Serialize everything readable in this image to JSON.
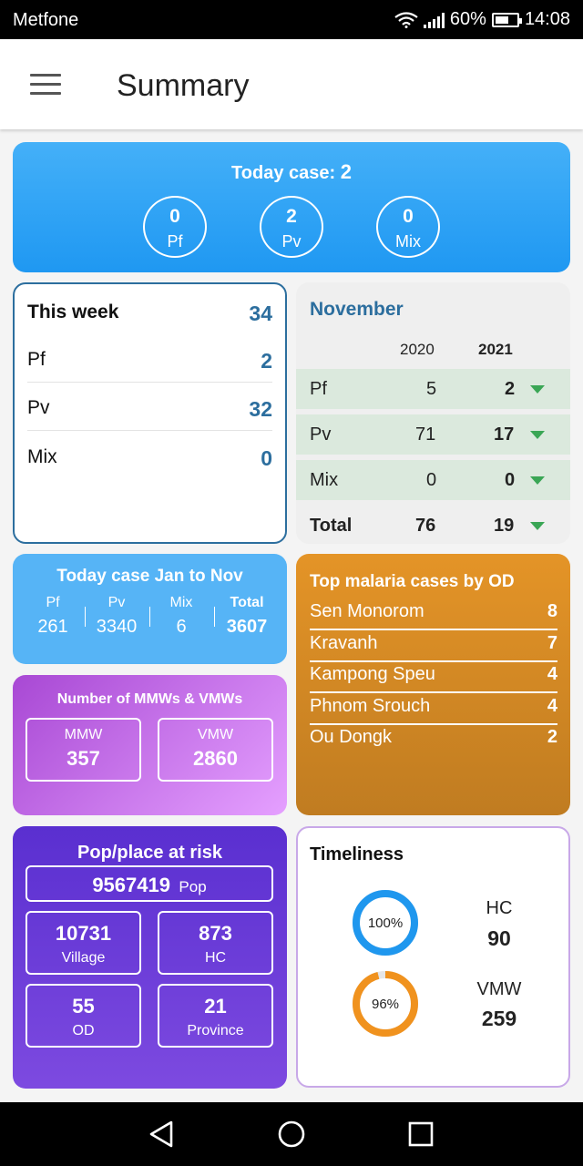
{
  "status": {
    "carrier": "Metfone",
    "battery": "60%",
    "time": "14:08"
  },
  "header": {
    "title": "Summary"
  },
  "today": {
    "label": "Today case:",
    "total": "2",
    "items": [
      {
        "value": "0",
        "label": "Pf"
      },
      {
        "value": "2",
        "label": "Pv"
      },
      {
        "value": "0",
        "label": "Mix"
      }
    ]
  },
  "week": {
    "title": "This week",
    "total": "34",
    "rows": [
      {
        "label": "Pf",
        "value": "2"
      },
      {
        "label": "Pv",
        "value": "32"
      },
      {
        "label": "Mix",
        "value": "0"
      }
    ]
  },
  "month": {
    "title": "November",
    "years": [
      "2020",
      "2021"
    ],
    "rows": [
      {
        "label": "Pf",
        "prev": "5",
        "curr": "2"
      },
      {
        "label": "Pv",
        "prev": "71",
        "curr": "17"
      },
      {
        "label": "Mix",
        "prev": "0",
        "curr": "0"
      },
      {
        "label": "Total",
        "prev": "76",
        "curr": "19"
      }
    ],
    "trend_color": "#3aa655"
  },
  "jan_nov": {
    "title": "Today case Jan to Nov",
    "cols": [
      {
        "label": "Pf",
        "value": "261"
      },
      {
        "label": "Pv",
        "value": "3340"
      },
      {
        "label": "Mix",
        "value": "6"
      },
      {
        "label": "Total",
        "value": "3607"
      }
    ]
  },
  "workers": {
    "title": "Number of MMWs & VMWs",
    "boxes": [
      {
        "label": "MMW",
        "value": "357"
      },
      {
        "label": "VMW",
        "value": "2860"
      }
    ]
  },
  "top_od": {
    "title": "Top malaria cases by OD",
    "items": [
      {
        "name": "Sen Monorom",
        "value": "8"
      },
      {
        "name": "Kravanh",
        "value": "7"
      },
      {
        "name": "Kampong Speu",
        "value": "4"
      },
      {
        "name": "Phnom Srouch",
        "value": "4"
      },
      {
        "name": "Ou Dongk",
        "value": "2"
      }
    ]
  },
  "risk": {
    "title": "Pop/place at risk",
    "pop_value": "9567419",
    "pop_label": "Pop",
    "boxes": [
      {
        "value": "10731",
        "label": "Village"
      },
      {
        "value": "873",
        "label": "HC"
      },
      {
        "value": "55",
        "label": "OD"
      },
      {
        "value": "21",
        "label": "Province"
      }
    ]
  },
  "timeliness": {
    "title": "Timeliness",
    "items": [
      {
        "percent_text": "100%",
        "percent": 100,
        "label": "HC",
        "value": "90",
        "color": "#1f97ee"
      },
      {
        "percent_text": "96%",
        "percent": 96,
        "label": "VMW",
        "value": "259",
        "color": "#f0921e"
      }
    ]
  }
}
